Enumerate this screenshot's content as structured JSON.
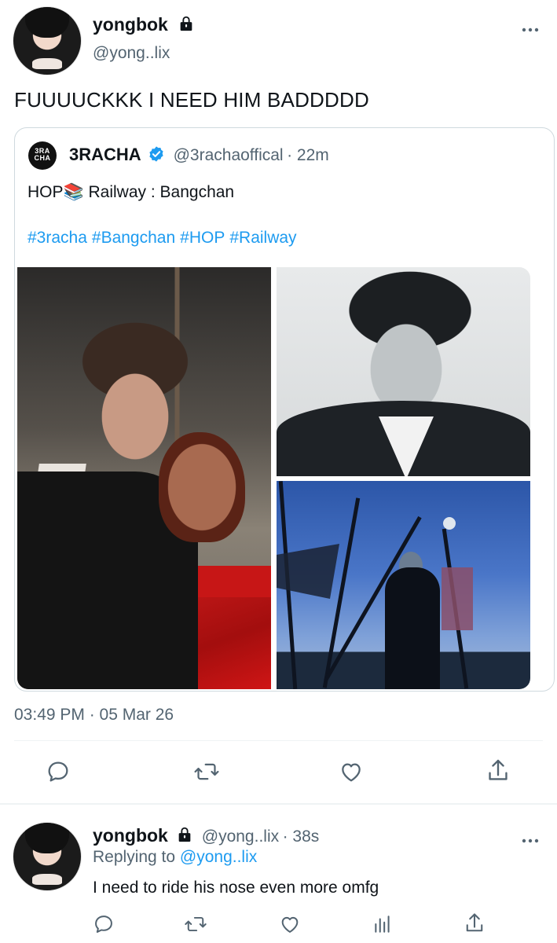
{
  "main_tweet": {
    "author_name": "yongbok",
    "author_handle": "@yong..lix",
    "text": "FUUUUCKKK I NEED HIM BADDDDD",
    "timestamp": "03:49 PM · 05 Mar 26",
    "menu_icon": "more-dots-icon"
  },
  "quote": {
    "author_name": "3RACHA",
    "verified_icon": "verified-badge-icon",
    "author_handle": "@3rachaoffical",
    "time": "22m",
    "logo_text": "3RA CHA",
    "text_before": "HOP",
    "emoji": "📚",
    "text_after": " Railway : Bangchan",
    "hashtags": [
      "#3racha",
      "#Bangchan",
      "#HOP",
      "#Railway"
    ]
  },
  "actions": {
    "reply_icon": "reply-icon",
    "retweet_icon": "retweet-icon",
    "like_icon": "like-icon",
    "share_icon": "share-icon",
    "views_icon": "views-icon"
  },
  "reply_tweet": {
    "author_name": "yongbok",
    "author_handle": "@yong..lix",
    "time": "38s",
    "replying_prefix": "Replying to",
    "replying_handle": "@yong..lix",
    "text": "I need to ride his nose even more omfg"
  }
}
